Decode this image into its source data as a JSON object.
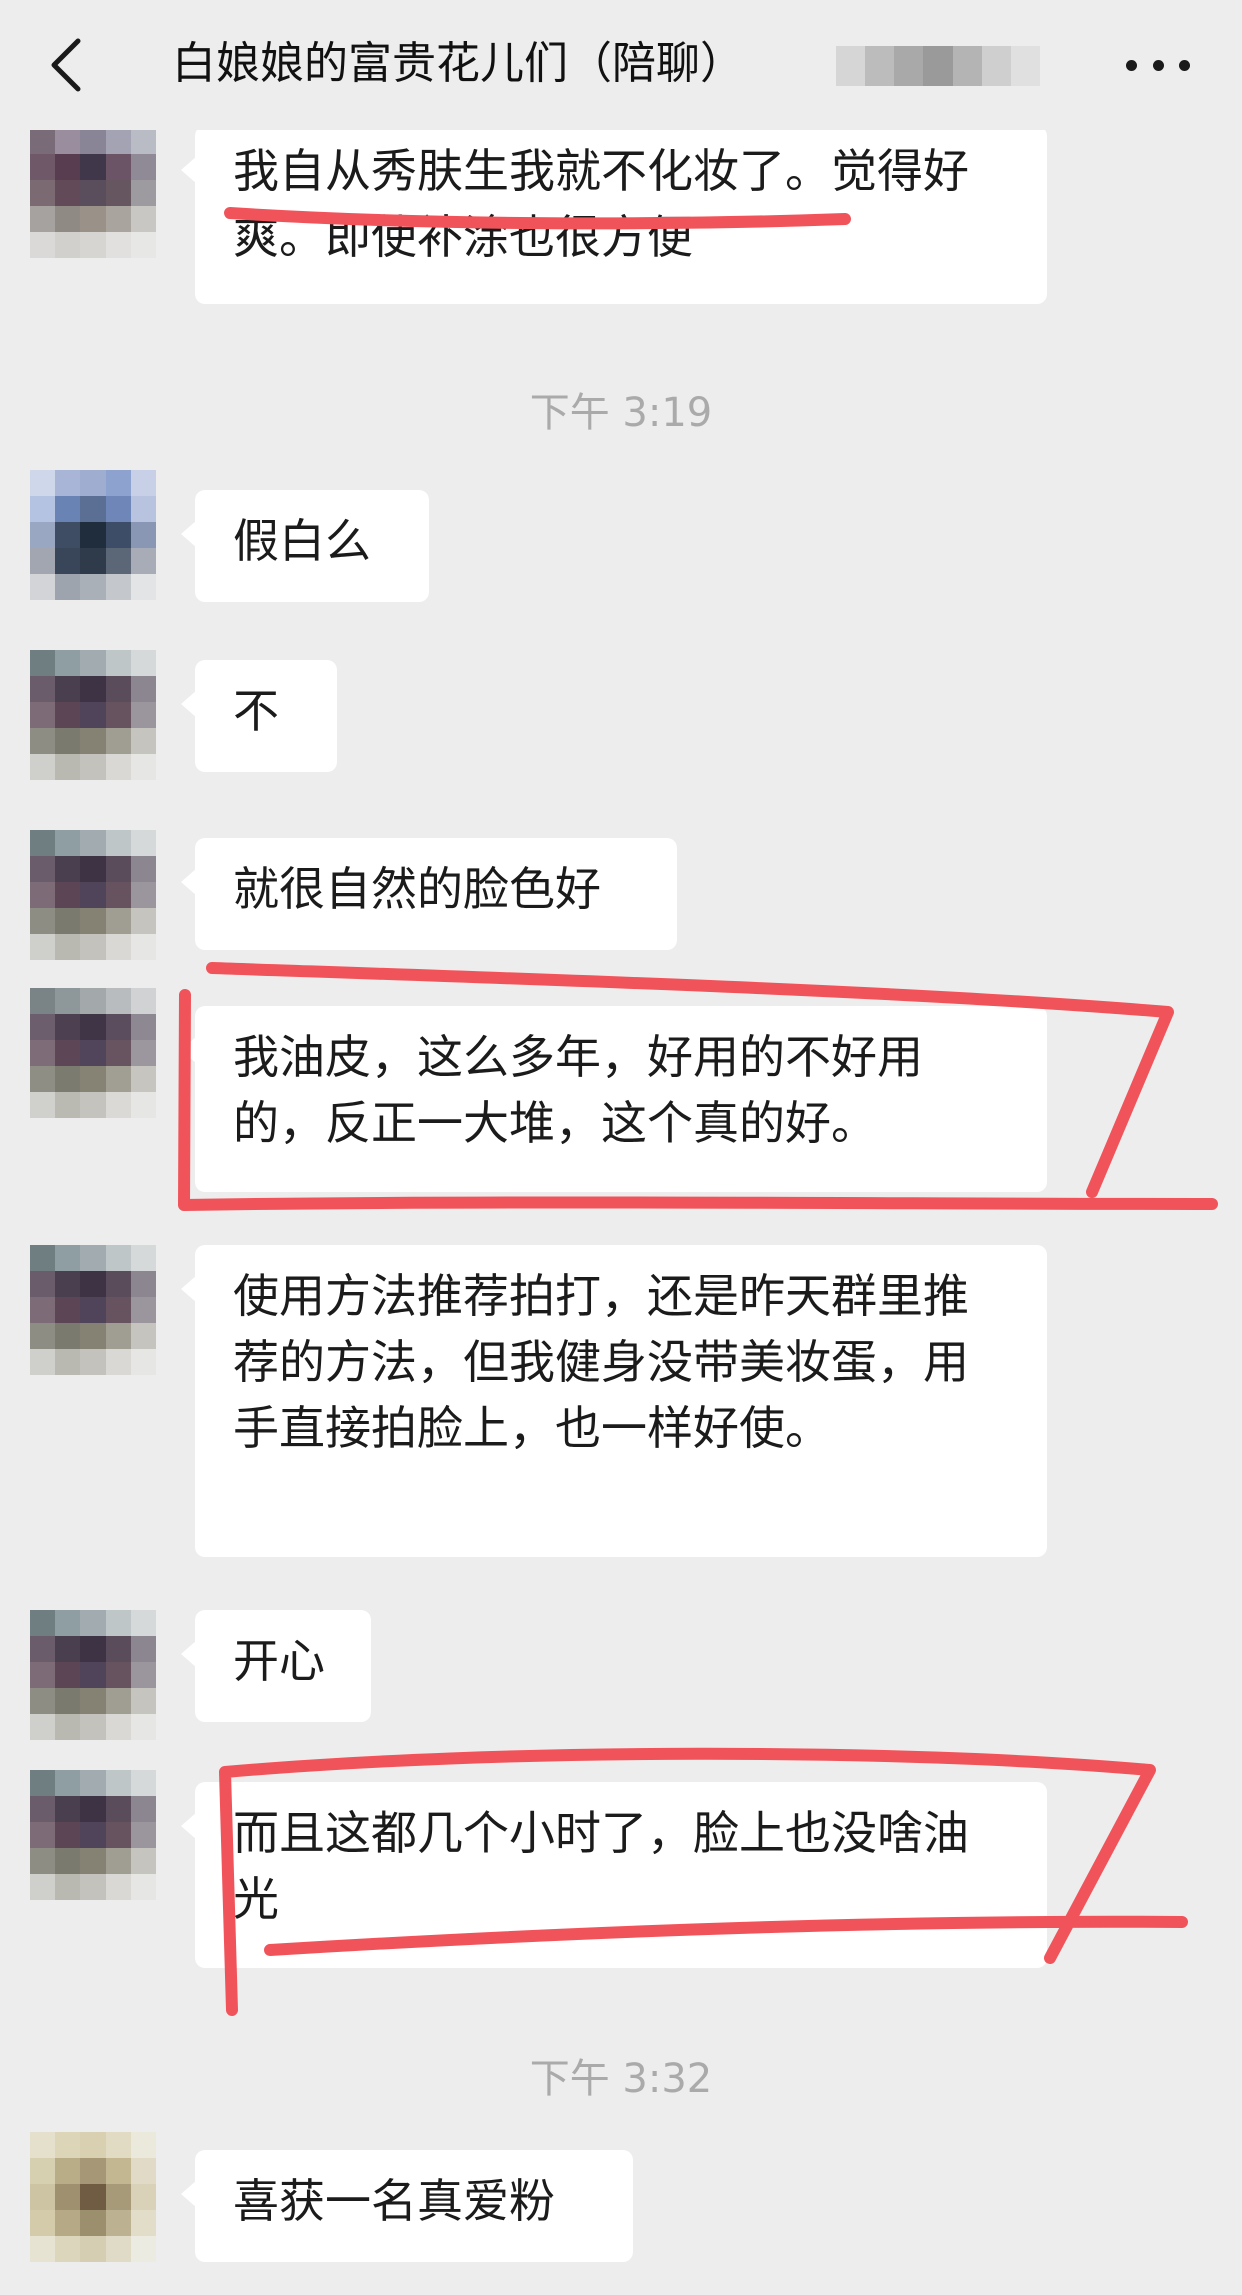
{
  "header": {
    "title": "白娘娘的富贵花儿们（陪聊）",
    "back_icon": "chevron-left-icon",
    "more_icon": "more-dots-icon"
  },
  "messages": [
    {
      "text": "我自从秀肤生我就不化妆了。觉得好爽。即使补涂也很方便"
    },
    {
      "time": "下午 3:19"
    },
    {
      "text": "假白么"
    },
    {
      "text": "不"
    },
    {
      "text": "就很自然的脸色好"
    },
    {
      "text": "我油皮，这么多年，好用的不好用的，反正一大堆，这个真的好。"
    },
    {
      "text": "使用方法推荐拍打，还是昨天群里推荐的方法，但我健身没带美妆蛋，用手直接拍脸上，也一样好使。"
    },
    {
      "text": "开心"
    },
    {
      "text": "而且这都几个小时了，脸上也没啥油光"
    },
    {
      "time": "下午 3:32"
    },
    {
      "text": "喜获一名真爱粉"
    }
  ],
  "colors": {
    "background": "#ededed",
    "bubble": "#ffffff",
    "annotation": "#f0545a"
  }
}
